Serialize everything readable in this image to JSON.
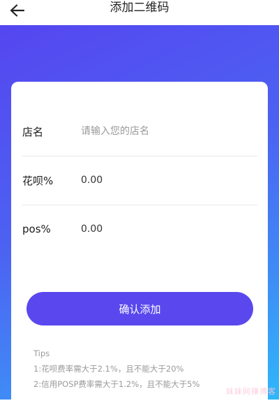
{
  "header": {
    "title": "添加二维码",
    "back_icon": "arrow-left-icon"
  },
  "form": {
    "fields": [
      {
        "label": "店名",
        "value": "",
        "placeholder": "请输入您的店名"
      },
      {
        "label": "花呗%",
        "value": "0.00",
        "placeholder": ""
      },
      {
        "label": "pos%",
        "value": "0.00",
        "placeholder": ""
      }
    ],
    "submit_label": "确认添加"
  },
  "tips": {
    "heading": "Tips",
    "items": [
      "1:花呗费率需大于2.1%，且不能大于20%",
      "2:信用POSP费率需大于1.2%，且不能大于5%"
    ]
  },
  "watermark": "妹妹网赚博客",
  "colors": {
    "accent": "#5a48ee",
    "gradient_start": "#5546f0",
    "gradient_end": "#2fb8fa"
  }
}
